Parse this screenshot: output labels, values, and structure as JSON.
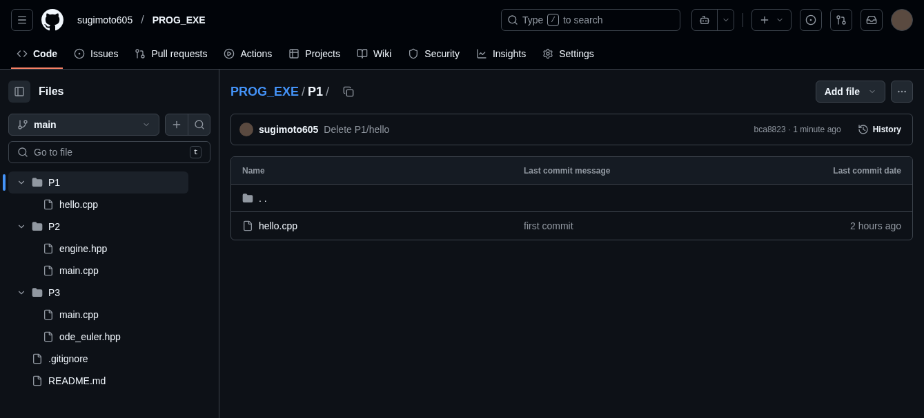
{
  "header": {
    "owner": "sugimoto605",
    "separator": "/",
    "repo": "PROG_EXE",
    "search": {
      "placeholder_before": "Type",
      "key": "/",
      "placeholder_after": "to search"
    }
  },
  "tabs": [
    {
      "label": "Code",
      "selected": true
    },
    {
      "label": "Issues",
      "selected": false
    },
    {
      "label": "Pull requests",
      "selected": false
    },
    {
      "label": "Actions",
      "selected": false
    },
    {
      "label": "Projects",
      "selected": false
    },
    {
      "label": "Wiki",
      "selected": false
    },
    {
      "label": "Security",
      "selected": false
    },
    {
      "label": "Insights",
      "selected": false
    },
    {
      "label": "Settings",
      "selected": false
    }
  ],
  "sidebar": {
    "title": "Files",
    "branch": "main",
    "go_to_file": {
      "placeholder": "Go to file",
      "shortcut": "t"
    },
    "tree": [
      {
        "kind": "folder",
        "name": "P1",
        "expanded": true,
        "selected": true,
        "children": [
          {
            "kind": "file",
            "name": "hello.cpp",
            "selected": false
          }
        ]
      },
      {
        "kind": "folder",
        "name": "P2",
        "expanded": true,
        "selected": false,
        "children": [
          {
            "kind": "file",
            "name": "engine.hpp",
            "selected": false
          },
          {
            "kind": "file",
            "name": "main.cpp",
            "selected": false
          }
        ]
      },
      {
        "kind": "folder",
        "name": "P3",
        "expanded": true,
        "selected": false,
        "children": [
          {
            "kind": "file",
            "name": "main.cpp",
            "selected": false
          },
          {
            "kind": "file",
            "name": "ode_euler.hpp",
            "selected": false
          }
        ]
      },
      {
        "kind": "file",
        "name": ".gitignore",
        "selected": false
      },
      {
        "kind": "file",
        "name": "README.md",
        "selected": false
      }
    ]
  },
  "breadcrumb": [
    {
      "kind": "repo",
      "label": "PROG_EXE"
    },
    {
      "kind": "separator",
      "label": "/"
    },
    {
      "kind": "folder",
      "label": "P1"
    },
    {
      "kind": "separator",
      "label": "/"
    }
  ],
  "add_file": "Add file",
  "commit": {
    "author": "sugimoto605",
    "message": "Delete P1/hello",
    "meta": "bca8823 · 1 minute ago",
    "history": "History"
  },
  "table": {
    "columns": [
      "Name",
      "Last commit message",
      "Last commit date"
    ],
    "rows": [
      {
        "kind": "parent",
        "name": ". ."
      },
      {
        "kind": "file",
        "name": "hello.cpp",
        "message": "first commit",
        "date": "2 hours ago"
      }
    ]
  }
}
